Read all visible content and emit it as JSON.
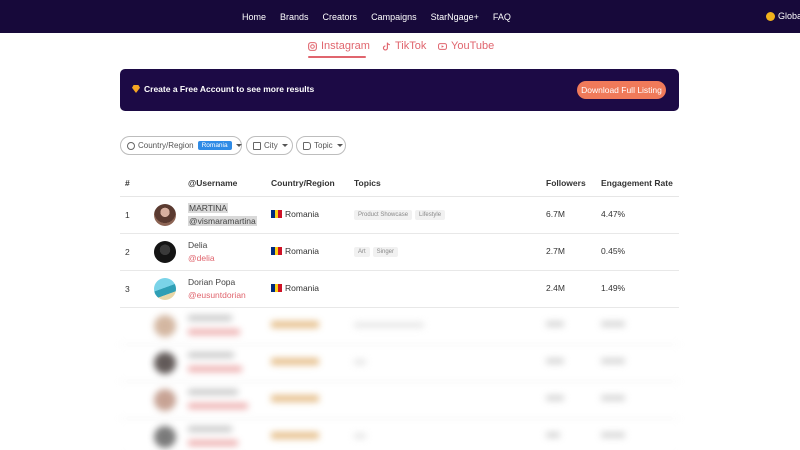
{
  "nav": {
    "links": [
      "Home",
      "Brands",
      "Creators",
      "Campaigns",
      "StarNgage+",
      "FAQ"
    ],
    "language": "Globa"
  },
  "platform_tabs": {
    "instagram": "Instagram",
    "tiktok": "TikTok",
    "youtube": "YouTube",
    "active": "instagram"
  },
  "banner": {
    "text": "Create a Free Account to see more results",
    "button": "Download Full Listing"
  },
  "filters": {
    "country_label": "Country/Region",
    "country_value": "Romania",
    "city_label": "City",
    "topic_label": "Topic"
  },
  "table": {
    "headers": {
      "rank": "#",
      "username": "@Username",
      "country": "Country/Region",
      "topics": "Topics",
      "followers": "Followers",
      "engagement": "Engagement Rate"
    },
    "rows": [
      {
        "rank": "1",
        "name": "MARTINA",
        "handle": "@vismaramartina",
        "country": "Romania",
        "topics": [
          "Product Showcase",
          "Lifestyle"
        ],
        "followers": "6.7M",
        "engagement": "4.47%"
      },
      {
        "rank": "2",
        "name": "Delia",
        "handle": "@delia",
        "country": "Romania",
        "topics": [
          "Art",
          "Singer"
        ],
        "followers": "2.7M",
        "engagement": "0.45%"
      },
      {
        "rank": "3",
        "name": "Dorian Popa",
        "handle": "@eusuntdorian",
        "country": "Romania",
        "topics": [],
        "followers": "2.4M",
        "engagement": "1.49%"
      }
    ]
  },
  "colors": {
    "nav_bg": "#17093a",
    "banner_bg": "#1c0a45",
    "accent": "#e0656e",
    "button": "#f07a5a",
    "badge": "#2f8be6"
  }
}
